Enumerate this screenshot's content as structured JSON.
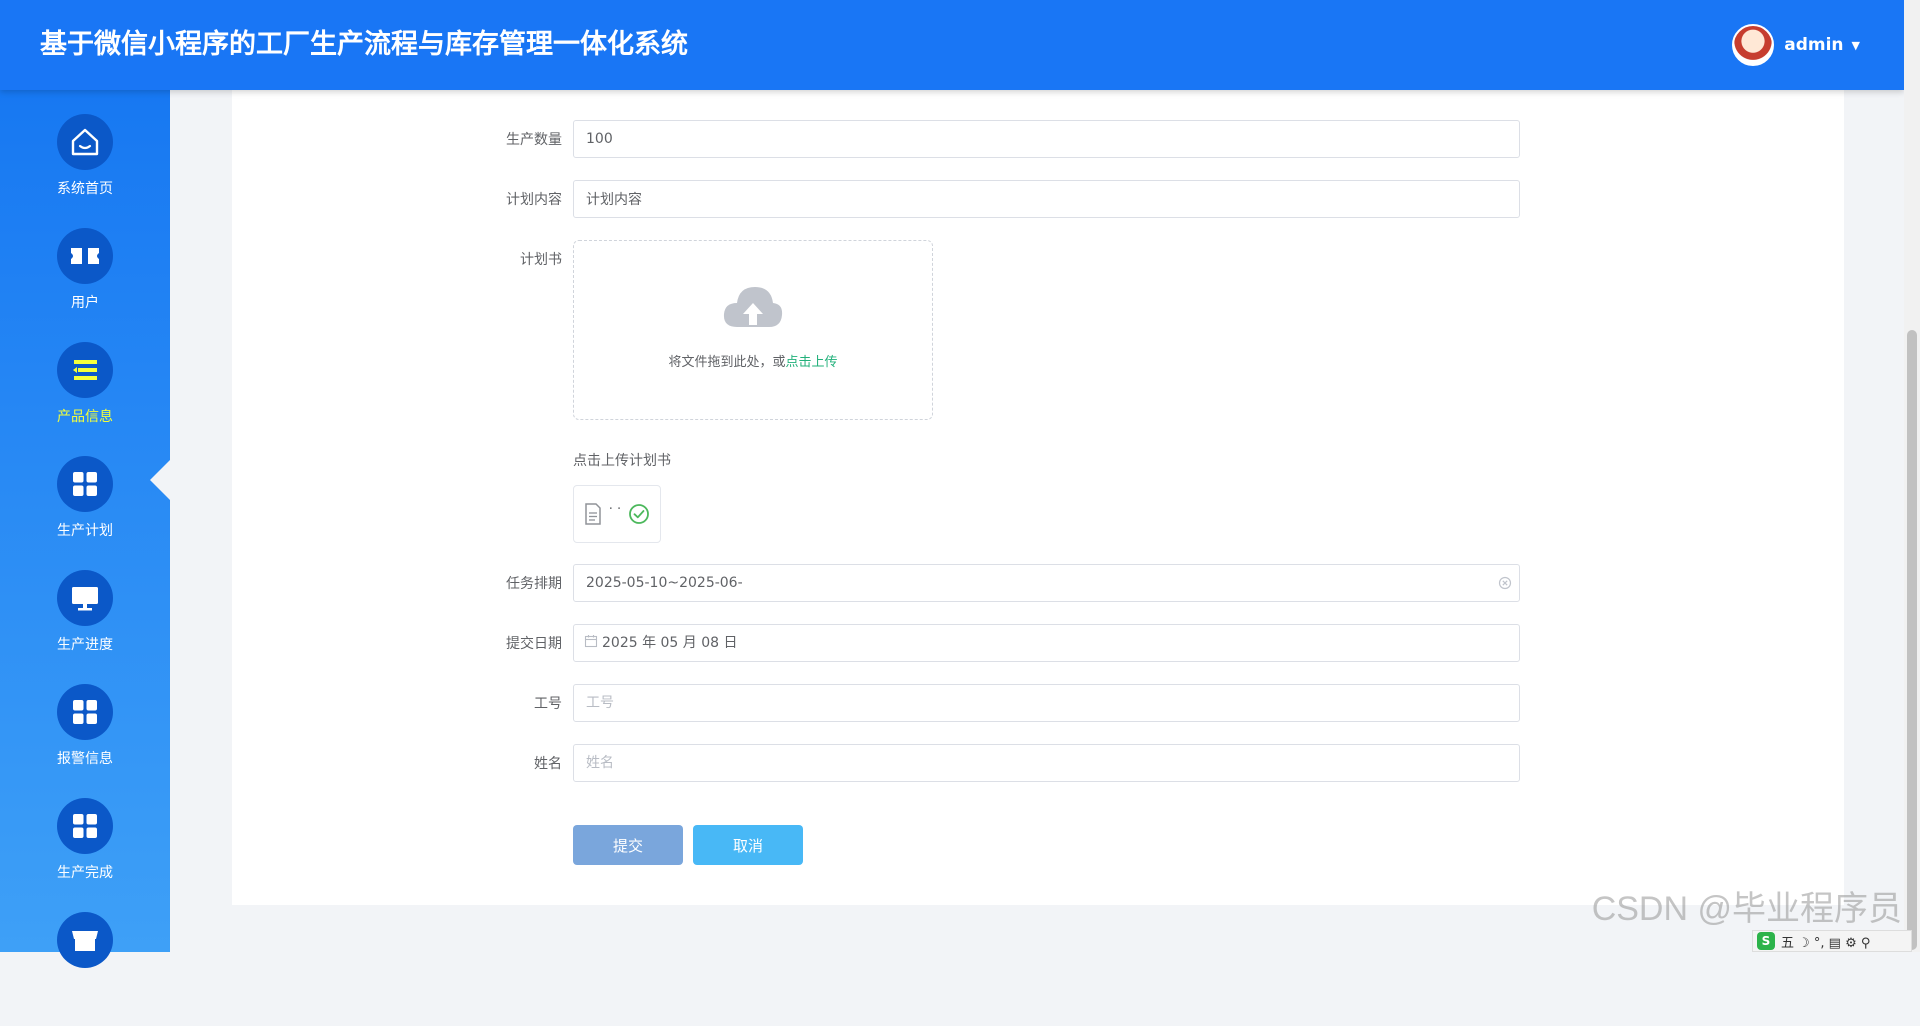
{
  "header": {
    "title": "基于微信小程序的工厂生产流程与库存管理一体化系统",
    "username": "admin",
    "caret": "▼"
  },
  "sidebar": {
    "items": [
      {
        "label": "系统首页",
        "icon": "home-icon"
      },
      {
        "label": "用户",
        "icon": "ticket-icon"
      },
      {
        "label": "产品信息",
        "icon": "list-icon",
        "active": true
      },
      {
        "label": "生产计划",
        "icon": "grid-icon"
      },
      {
        "label": "生产进度",
        "icon": "monitor-icon"
      },
      {
        "label": "报警信息",
        "icon": "grid-icon"
      },
      {
        "label": "生产完成",
        "icon": "grid-icon"
      },
      {
        "label": "",
        "icon": "store-icon"
      }
    ],
    "active_color": "#f3ff3b"
  },
  "form": {
    "quantity": {
      "label": "生产数量",
      "value": "100"
    },
    "plan_content": {
      "label": "计划内容",
      "value": "计划内容"
    },
    "plan_book": {
      "label": "计划书",
      "upload_text": "将文件拖到此处，或",
      "upload_link": "点击上传",
      "tip": "点击上传计划书",
      "file_name": "· ·"
    },
    "schedule": {
      "label": "任务排期",
      "value": "2025-05-10~2025-06-"
    },
    "submit_date": {
      "label": "提交日期",
      "value": "2025 年 05 月 08 日"
    },
    "work_no": {
      "label": "工号",
      "placeholder": "工号"
    },
    "name": {
      "label": "姓名",
      "placeholder": "姓名"
    },
    "submit_label": "提交",
    "cancel_label": "取消"
  },
  "watermark": "CSDN @毕业程序员",
  "ime": {
    "logo": "S",
    "mode": "五 ☽ °, ▤ ⚙ ⚲"
  },
  "colors": {
    "header_bg": "#1976f5",
    "submit_bg": "#7aa6dc",
    "cancel_bg": "#48b8f6",
    "link": "#21b07a",
    "success": "#4cb85c"
  }
}
